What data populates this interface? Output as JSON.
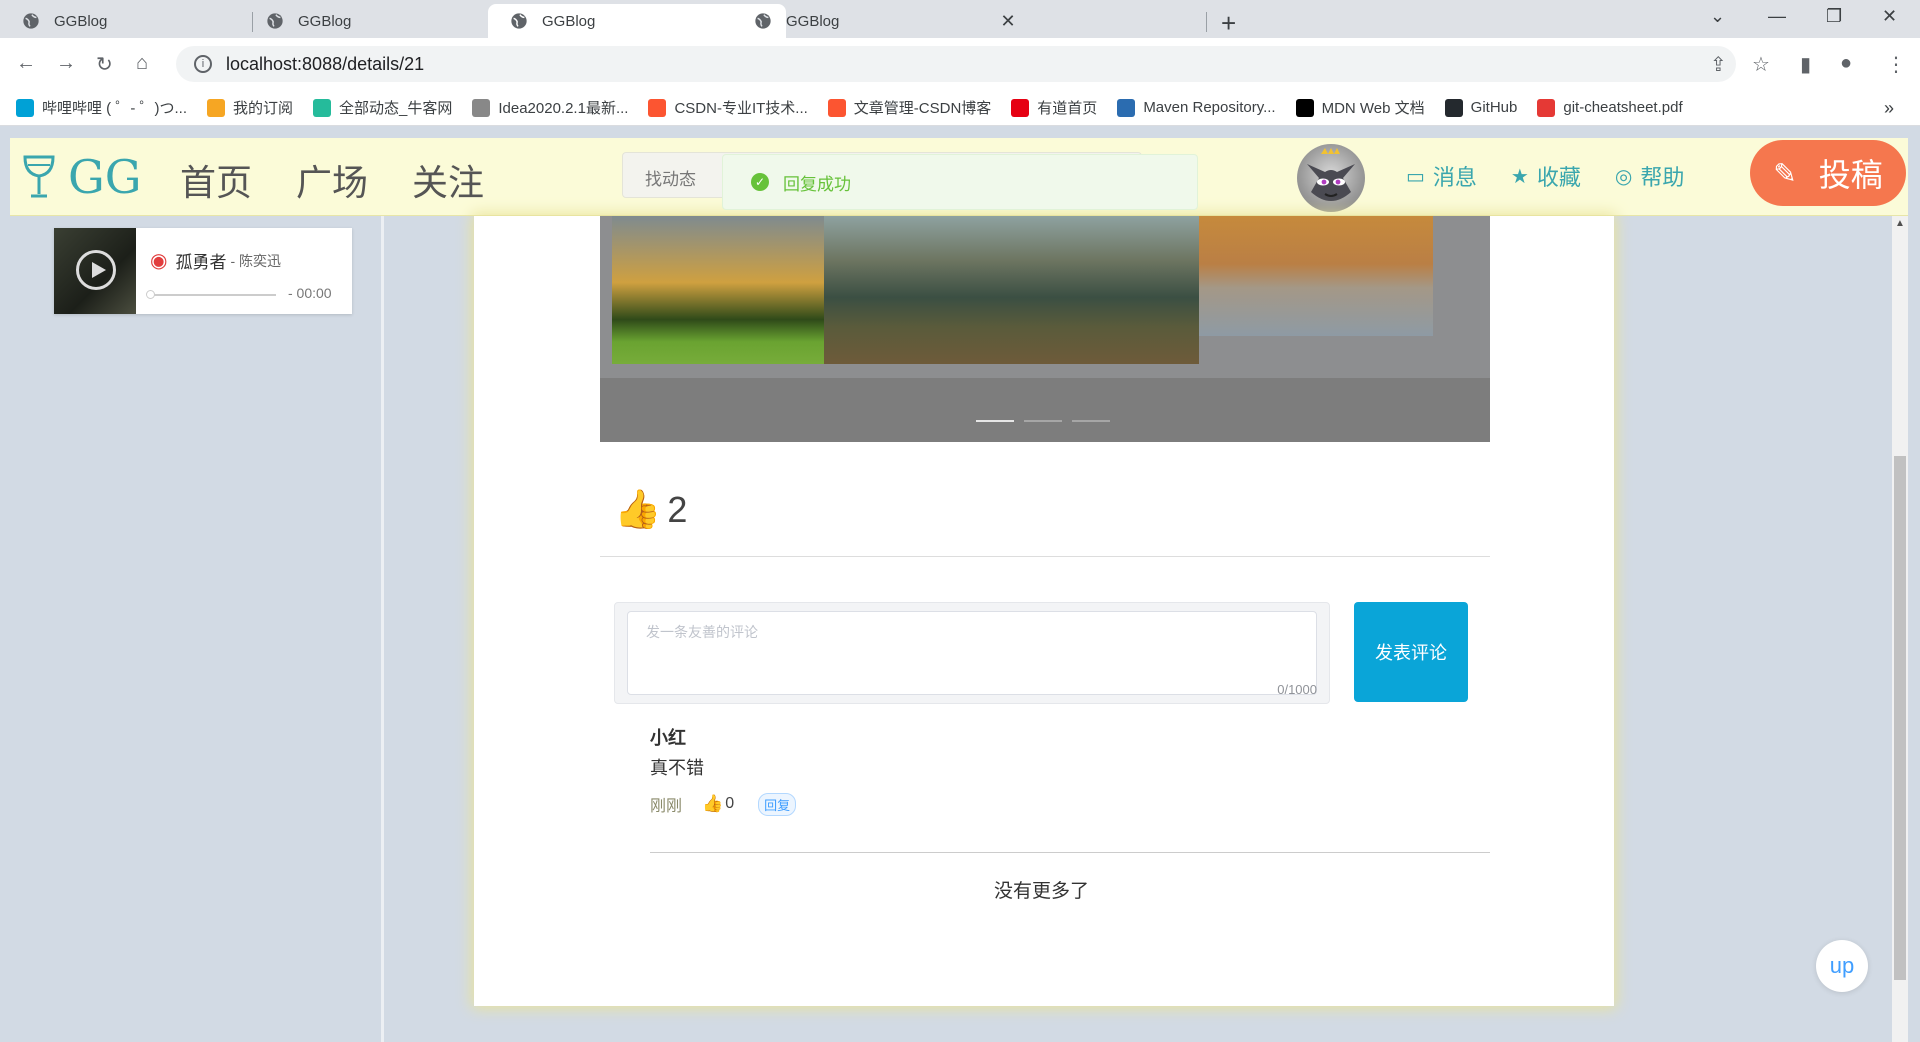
{
  "browser": {
    "tabs": [
      {
        "title": "GGBlog"
      },
      {
        "title": "GGBlog"
      },
      {
        "title": "GGBlog"
      },
      {
        "title": "GGBlog"
      }
    ],
    "url": "localhost:8088/details/21",
    "bookmarks": [
      {
        "label": "哔哩哔哩 ( ゜- ゜)つ...",
        "color": "#00a1d6"
      },
      {
        "label": "我的订阅",
        "color": "#f6a623"
      },
      {
        "label": "全部动态_牛客网",
        "color": "#25bb9b"
      },
      {
        "label": "Idea2020.2.1最新...",
        "color": "#888888"
      },
      {
        "label": "CSDN-专业IT技术...",
        "color": "#fc5531"
      },
      {
        "label": "文章管理-CSDN博客",
        "color": "#fc5531"
      },
      {
        "label": "有道首页",
        "color": "#e60012"
      },
      {
        "label": "Maven Repository...",
        "color": "#2b6cb0"
      },
      {
        "label": "MDN Web 文档",
        "color": "#000000"
      },
      {
        "label": "GitHub",
        "color": "#24292e"
      },
      {
        "label": "git-cheatsheet.pdf",
        "color": "#e53935"
      }
    ],
    "bookmarks_more": "»"
  },
  "site": {
    "logo_text": "GG",
    "nav": [
      "首页",
      "广场",
      "关注"
    ],
    "search_placeholder": "找动态",
    "toast": "回复成功",
    "links": [
      {
        "icon": "message-icon",
        "label": "消息"
      },
      {
        "icon": "star-icon",
        "label": "收藏"
      },
      {
        "icon": "help-icon",
        "label": "帮助"
      }
    ],
    "submit_label": "投稿",
    "accent": "#3aa6ae",
    "submit_color": "#f5774e"
  },
  "player": {
    "song": "孤勇者",
    "artist": "- 陈奕迅",
    "time": "- 00:00"
  },
  "post": {
    "likes": "2",
    "comment_placeholder": "发一条友善的评论",
    "counter": "0/1000",
    "post_button": "发表评论"
  },
  "comments": [
    {
      "user": "小红",
      "text": "真不错",
      "time": "刚刚",
      "likes": "0",
      "reply_label": "回复"
    }
  ],
  "footer_text": "没有更多了",
  "up_label": "up"
}
